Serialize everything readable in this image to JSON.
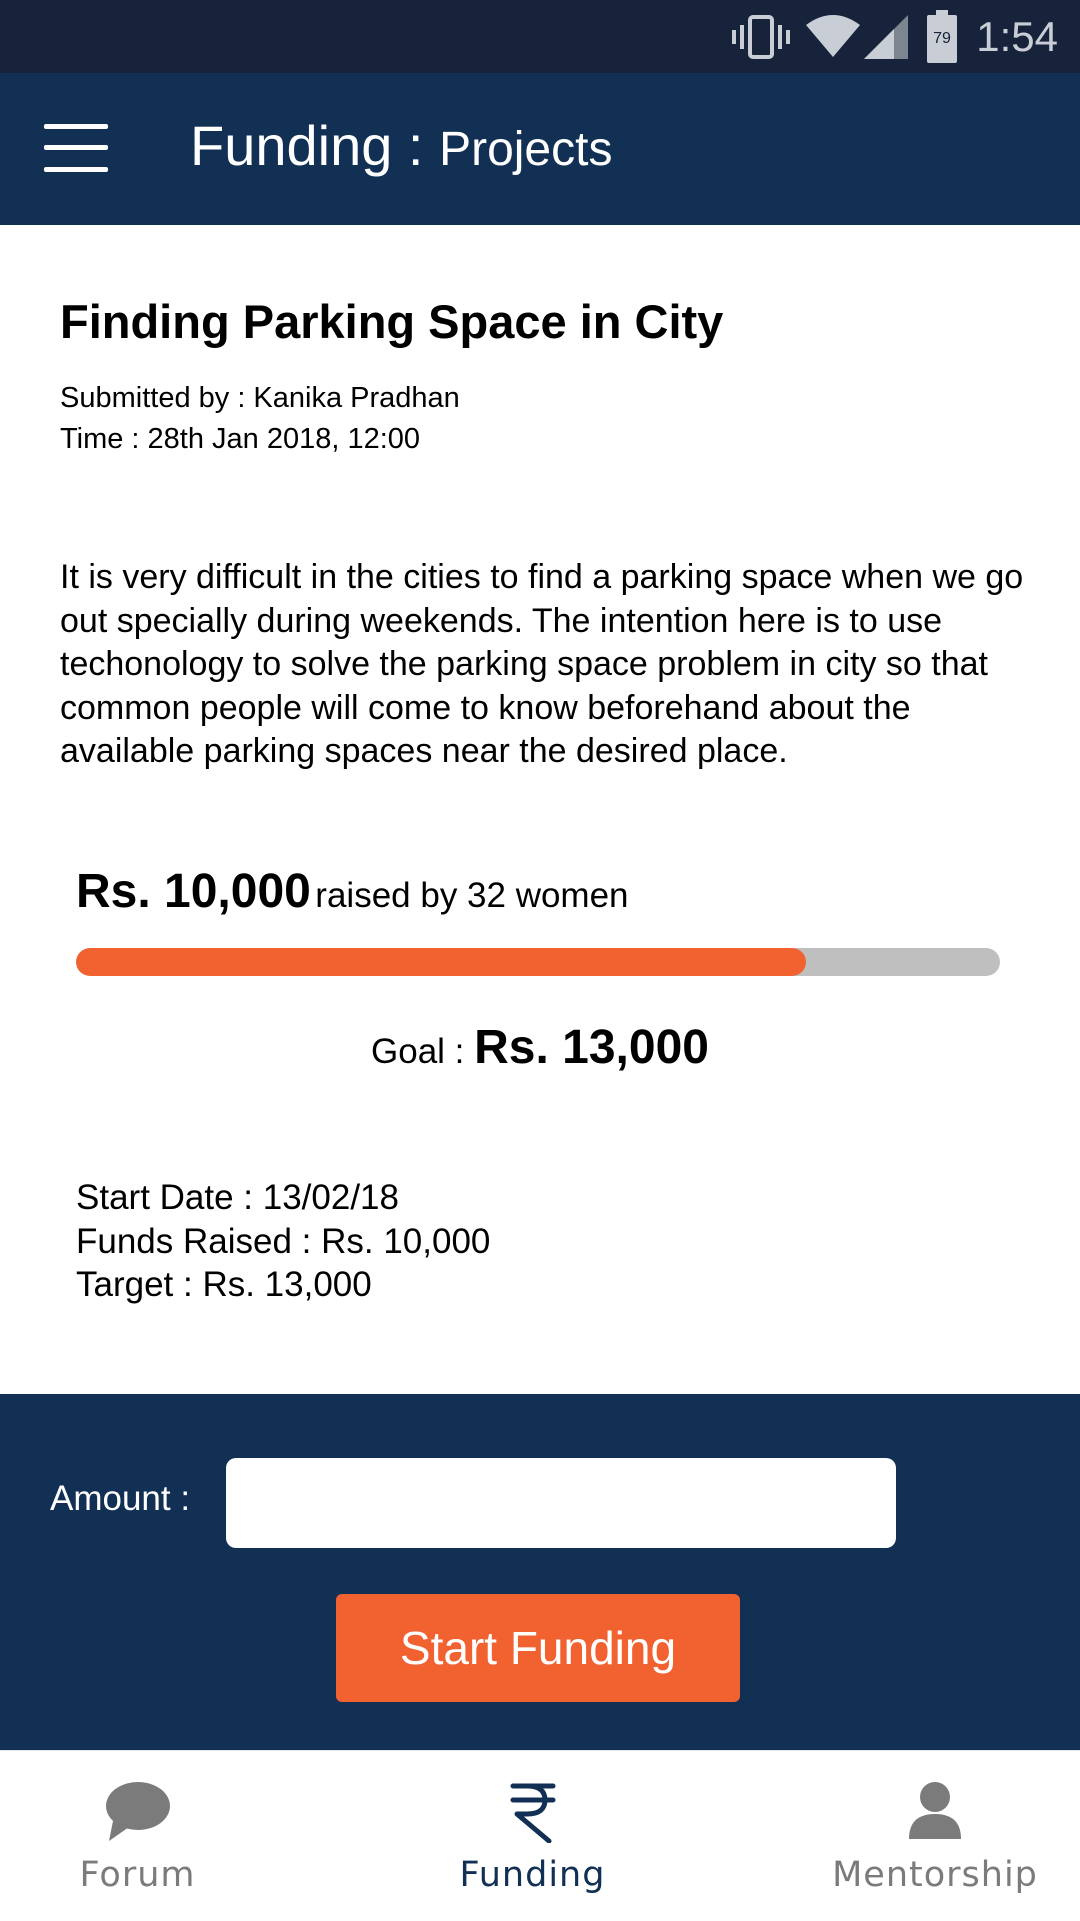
{
  "status_bar": {
    "time": "1:54",
    "battery_level": "79",
    "icons": [
      "vibrate-icon",
      "wifi-icon",
      "signal-icon",
      "battery-icon"
    ]
  },
  "app_bar": {
    "title": "Funding",
    "separator": " : ",
    "subtitle": "Projects",
    "menu_icon": "hamburger-menu-icon"
  },
  "project": {
    "title": "Finding Parking Space in City",
    "submitted_by": "Submitted by : Kanika Pradhan",
    "time": "Time : 28th Jan 2018, 12:00",
    "description": "It is very difficult in the cities to find a parking space when we go out specially during weekends. The intention here is to use techonology to solve the parking space problem in city so that common people will come to know beforehand about the available parking spaces near the desired place."
  },
  "funding": {
    "raised_amount": "Rs. 10,000",
    "raised_by": "raised by 32 women",
    "progress_fraction": 0.79,
    "goal_label": "Goal : ",
    "goal_value": "Rs. 13,000",
    "start_date": "Start Date : 13/02/18",
    "funds_raised": "Funds Raised : Rs. 10,000",
    "target": "Target : Rs. 13,000"
  },
  "form": {
    "amount_label": "Amount :",
    "amount_value": "",
    "submit_label": "Start Funding"
  },
  "bottom_nav": {
    "items": [
      {
        "label": "Forum",
        "icon": "chat-bubble-icon",
        "active": false
      },
      {
        "label": "Funding",
        "icon": "rupee-icon",
        "active": true
      },
      {
        "label": "Mentorship",
        "icon": "person-icon",
        "active": false
      }
    ]
  },
  "colors": {
    "status_bar": "#16233b",
    "primary": "#123054",
    "accent": "#f26130",
    "track": "#bfbfbf",
    "inactive": "#7b7b7b"
  }
}
